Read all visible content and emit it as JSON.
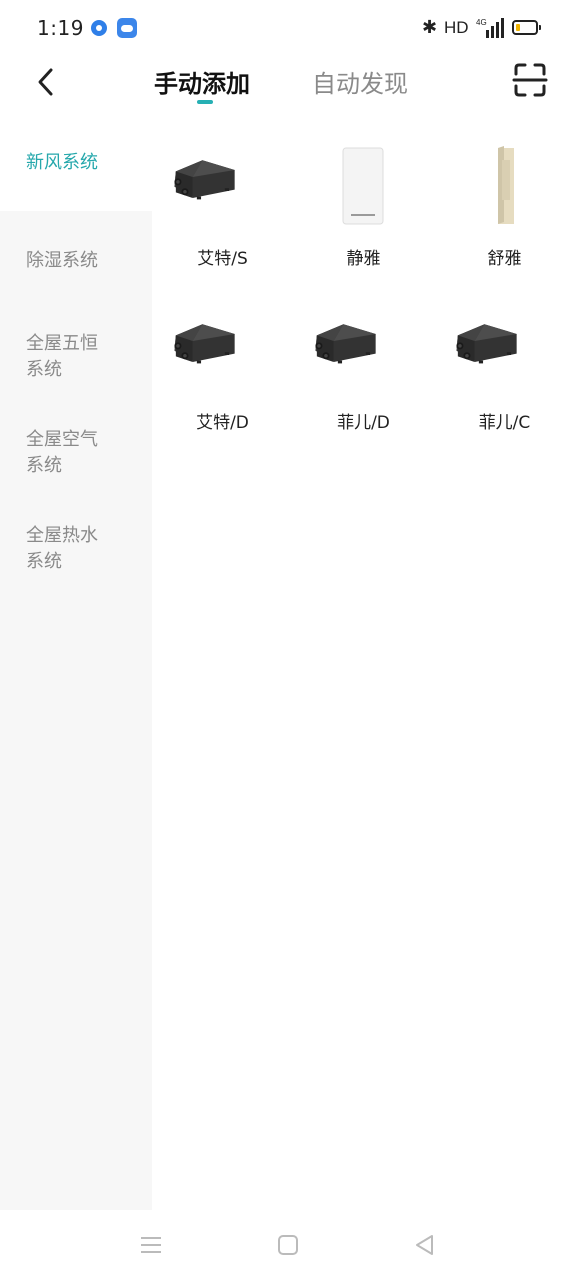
{
  "status_bar": {
    "time": "1:19",
    "bluetooth_icon": "bluetooth-icon",
    "hd_label": "HD",
    "network_label": "4G",
    "battery_icon": "battery-low-icon"
  },
  "header": {
    "back_icon": "chevron-left-icon",
    "tabs": [
      {
        "label": "手动添加",
        "active": true
      },
      {
        "label": "自动发现",
        "active": false
      }
    ],
    "scan_icon": "scan-icon",
    "accent_color": "#26b0b4"
  },
  "sidebar": {
    "items": [
      {
        "label": "新风系统",
        "active": true
      },
      {
        "label": "除湿系统",
        "active": false
      },
      {
        "label": "全屋五恒系统",
        "active": false
      },
      {
        "label": "全屋空气系统",
        "active": false
      },
      {
        "label": "全屋热水系统",
        "active": false
      }
    ]
  },
  "products": [
    {
      "name": "艾特/S",
      "icon": "ventilation-unit-icon"
    },
    {
      "name": "静雅",
      "icon": "wall-panel-icon"
    },
    {
      "name": "舒雅",
      "icon": "floor-column-icon"
    },
    {
      "name": "艾特/D",
      "icon": "ventilation-unit-icon"
    },
    {
      "name": "菲儿/D",
      "icon": "ventilation-unit-icon"
    },
    {
      "name": "菲儿/C",
      "icon": "ventilation-unit-icon"
    }
  ],
  "navbar": {
    "menu_icon": "menu-icon",
    "home_icon": "home-square-icon",
    "back_icon": "back-triangle-icon"
  }
}
